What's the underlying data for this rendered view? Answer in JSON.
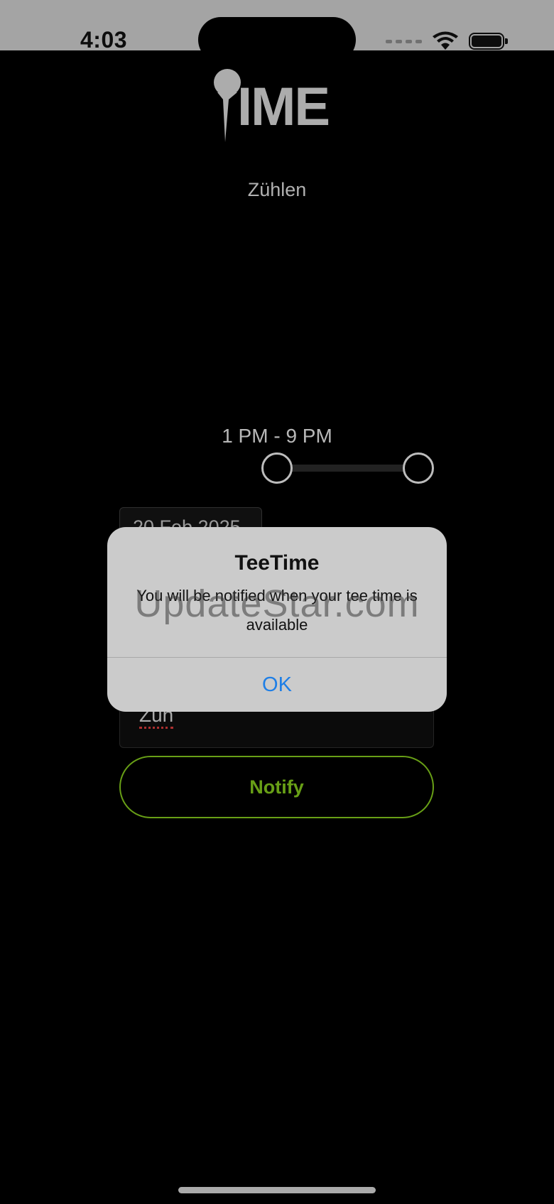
{
  "status_bar": {
    "time": "4:03"
  },
  "logo": {
    "text": "IME"
  },
  "course": {
    "name": "Zühlen"
  },
  "time_range": {
    "label": "1 PM - 9 PM"
  },
  "date_field": {
    "value": "20 Feb 2025"
  },
  "name_field": {
    "value": "Zuh"
  },
  "notify_button": {
    "label": "Notify",
    "color": "#7fc31c"
  },
  "alert": {
    "title": "TeeTime",
    "message": "You will be notified when your tee time is available",
    "ok_label": "OK",
    "ok_color": "#1f7fe6"
  },
  "watermark": {
    "text": "UpdateStar.com"
  }
}
